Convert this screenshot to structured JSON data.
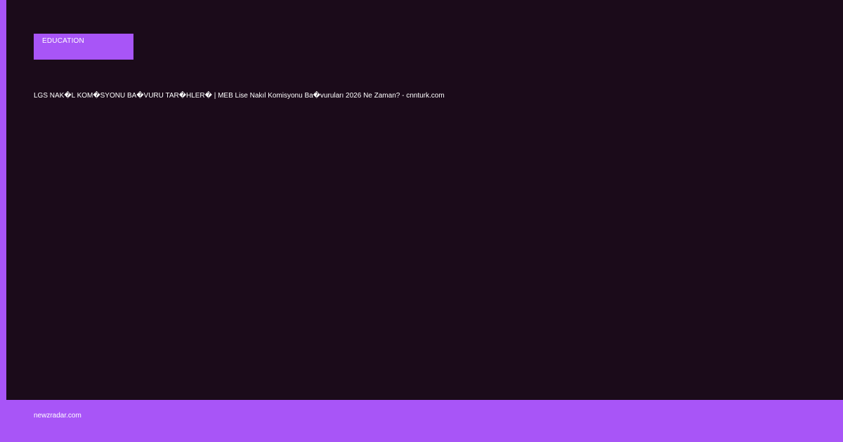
{
  "category": {
    "label": "EDUCATION"
  },
  "article": {
    "title": "LGS NAK�L KOM�SYONU BA�VURU TAR�HLER� | MEB Lise Nakıl Komisyonu Ba�vuruları 2026 Ne Zaman? - cnnturk.com"
  },
  "footer": {
    "domain": "newzradar.com"
  },
  "colors": {
    "accent": "#a855f7",
    "background": "#1b0b1a",
    "text": "#ffffff"
  }
}
